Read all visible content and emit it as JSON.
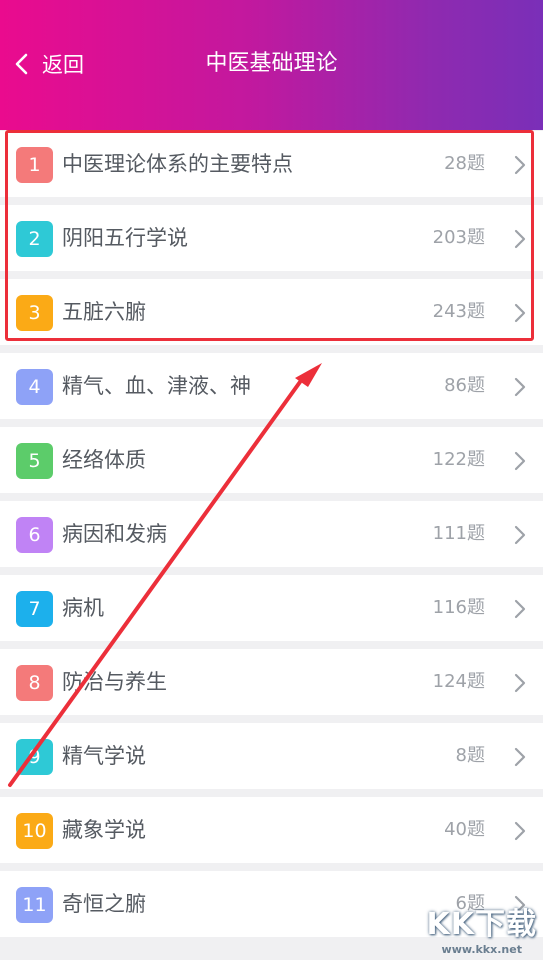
{
  "header": {
    "back_label": "返回",
    "title": "中医基础理论"
  },
  "list": {
    "items": [
      {
        "num": "1",
        "name": "中医理论体系的主要特点",
        "count": "28题",
        "color": "#f47a7a"
      },
      {
        "num": "2",
        "name": "阴阳五行学说",
        "count": "203题",
        "color": "#2ec9d6"
      },
      {
        "num": "3",
        "name": "五脏六腑",
        "count": "243题",
        "color": "#fbaa16"
      },
      {
        "num": "4",
        "name": "精气、血、津液、神",
        "count": "86题",
        "color": "#8ea2f7"
      },
      {
        "num": "5",
        "name": "经络体质",
        "count": "122题",
        "color": "#5ccc6a"
      },
      {
        "num": "6",
        "name": "病因和发病",
        "count": "111题",
        "color": "#c083f5"
      },
      {
        "num": "7",
        "name": "病机",
        "count": "116题",
        "color": "#1cb0ec"
      },
      {
        "num": "8",
        "name": "防治与养生",
        "count": "124题",
        "color": "#f47a7a"
      },
      {
        "num": "9",
        "name": "精气学说",
        "count": "8题",
        "color": "#2ec9d6"
      },
      {
        "num": "10",
        "name": "藏象学说",
        "count": "40题",
        "color": "#fbaa16"
      },
      {
        "num": "11",
        "name": "奇恒之腑",
        "count": "6题",
        "color": "#8ea2f7"
      }
    ]
  },
  "colors": {
    "header_start": "#ea0b8e",
    "header_end": "#7a2fb8",
    "highlight": "#ec2f3a"
  },
  "watermark": {
    "main": "KK下载",
    "sub": "www.kkx.net"
  }
}
